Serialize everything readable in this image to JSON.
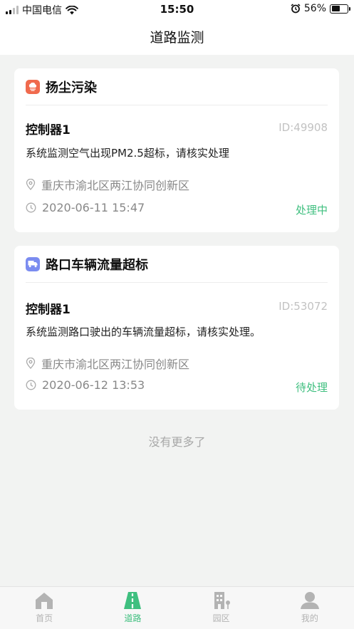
{
  "status_bar": {
    "carrier": "中国电信",
    "time": "15:50",
    "battery": "56%",
    "battery_level": 0.56
  },
  "header": {
    "title": "道路监测"
  },
  "alerts": [
    {
      "category": "扬尘污染",
      "category_icon": "dust-cloud-icon",
      "category_color": "#f06a4d",
      "controller": "控制器1",
      "id_label": "ID:49908",
      "description": "系统监测空气出现PM2.5超标，请核实处理",
      "location": "重庆市渝北区两江协同创新区",
      "timestamp": "2020-06-11 15:47",
      "status": "处理中"
    },
    {
      "category": "路口车辆流量超标",
      "category_icon": "truck-icon",
      "category_color": "#7b8cf0",
      "controller": "控制器1",
      "id_label": "ID:53072",
      "description": "系统监测路口驶出的车辆流量超标，请核实处理。",
      "location": "重庆市渝北区两江协同创新区",
      "timestamp": "2020-06-12 13:53",
      "status": "待处理"
    }
  ],
  "list_footer": "没有更多了",
  "tabbar": {
    "active_color": "#3fbf7f",
    "items": [
      {
        "label": "首页",
        "icon": "home-icon"
      },
      {
        "label": "道路",
        "icon": "road-icon",
        "active": true
      },
      {
        "label": "园区",
        "icon": "building-icon"
      },
      {
        "label": "我的",
        "icon": "user-icon"
      }
    ]
  }
}
